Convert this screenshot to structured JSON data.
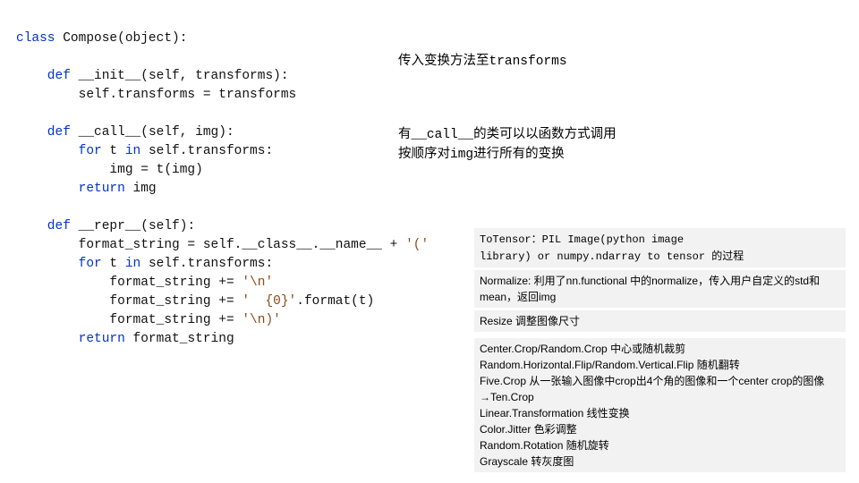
{
  "code": {
    "l01a": "class ",
    "l01b": "Compose(object):",
    "l02": "",
    "l03a": "    def ",
    "l03b": "__init__(self, transforms):",
    "l04": "        self.transforms = transforms",
    "l05": "",
    "l06a": "    def ",
    "l06b": "__call__(self, img):",
    "l07a": "        for ",
    "l07b": "t ",
    "l07c": "in ",
    "l07d": "self.transforms:",
    "l08": "            img = t(img)",
    "l09a": "        return ",
    "l09b": "img",
    "l10": "",
    "l11a": "    def ",
    "l11b": "__repr__(self):",
    "l12a": "        format_string = self.__class__.__name__ + ",
    "l12b": "'('",
    "l13a": "        for ",
    "l13b": "t ",
    "l13c": "in ",
    "l13d": "self.transforms:",
    "l14a": "            format_string += ",
    "l14b": "'\\n'",
    "l15a": "            format_string += ",
    "l15b": "'  {0}'",
    "l15c": ".format(t)",
    "l16a": "            format_string += ",
    "l16b": "'\\n)'",
    "l17a": "        return ",
    "l17b": "format_string"
  },
  "annot1": {
    "pre": "传入变换方法至",
    "mono": "transforms"
  },
  "annot2": {
    "pre": "有",
    "mono": "__call__",
    "post": "的类可以以函数方式调用",
    "line2a": "按顺序对",
    "line2b": "img",
    "line2c": "进行所有的变换"
  },
  "note1": {
    "a": "ToTensor：PIL Image(python image",
    "b": "library) or numpy.ndarray to tensor 的过程"
  },
  "note2": "Normalize: 利用了nn.functional 中的normalize，传入用户自定义的std和mean，返回img",
  "note3": "Resize 调整图像尺寸",
  "note4": {
    "l1": "Center.Crop/Random.Crop 中心或随机裁剪",
    "l2": "Random.Horizontal.Flip/Random.Vertical.Flip 随机翻转",
    "l3": "Five.Crop 从一张输入图像中crop出4个角的图像和一个center crop的图像→Ten.Crop",
    "l4": "Linear.Transformation 线性变换",
    "l5": "Color.Jitter 色彩调整",
    "l6": "Random.Rotation 随机旋转",
    "l7": "Grayscale 转灰度图"
  }
}
